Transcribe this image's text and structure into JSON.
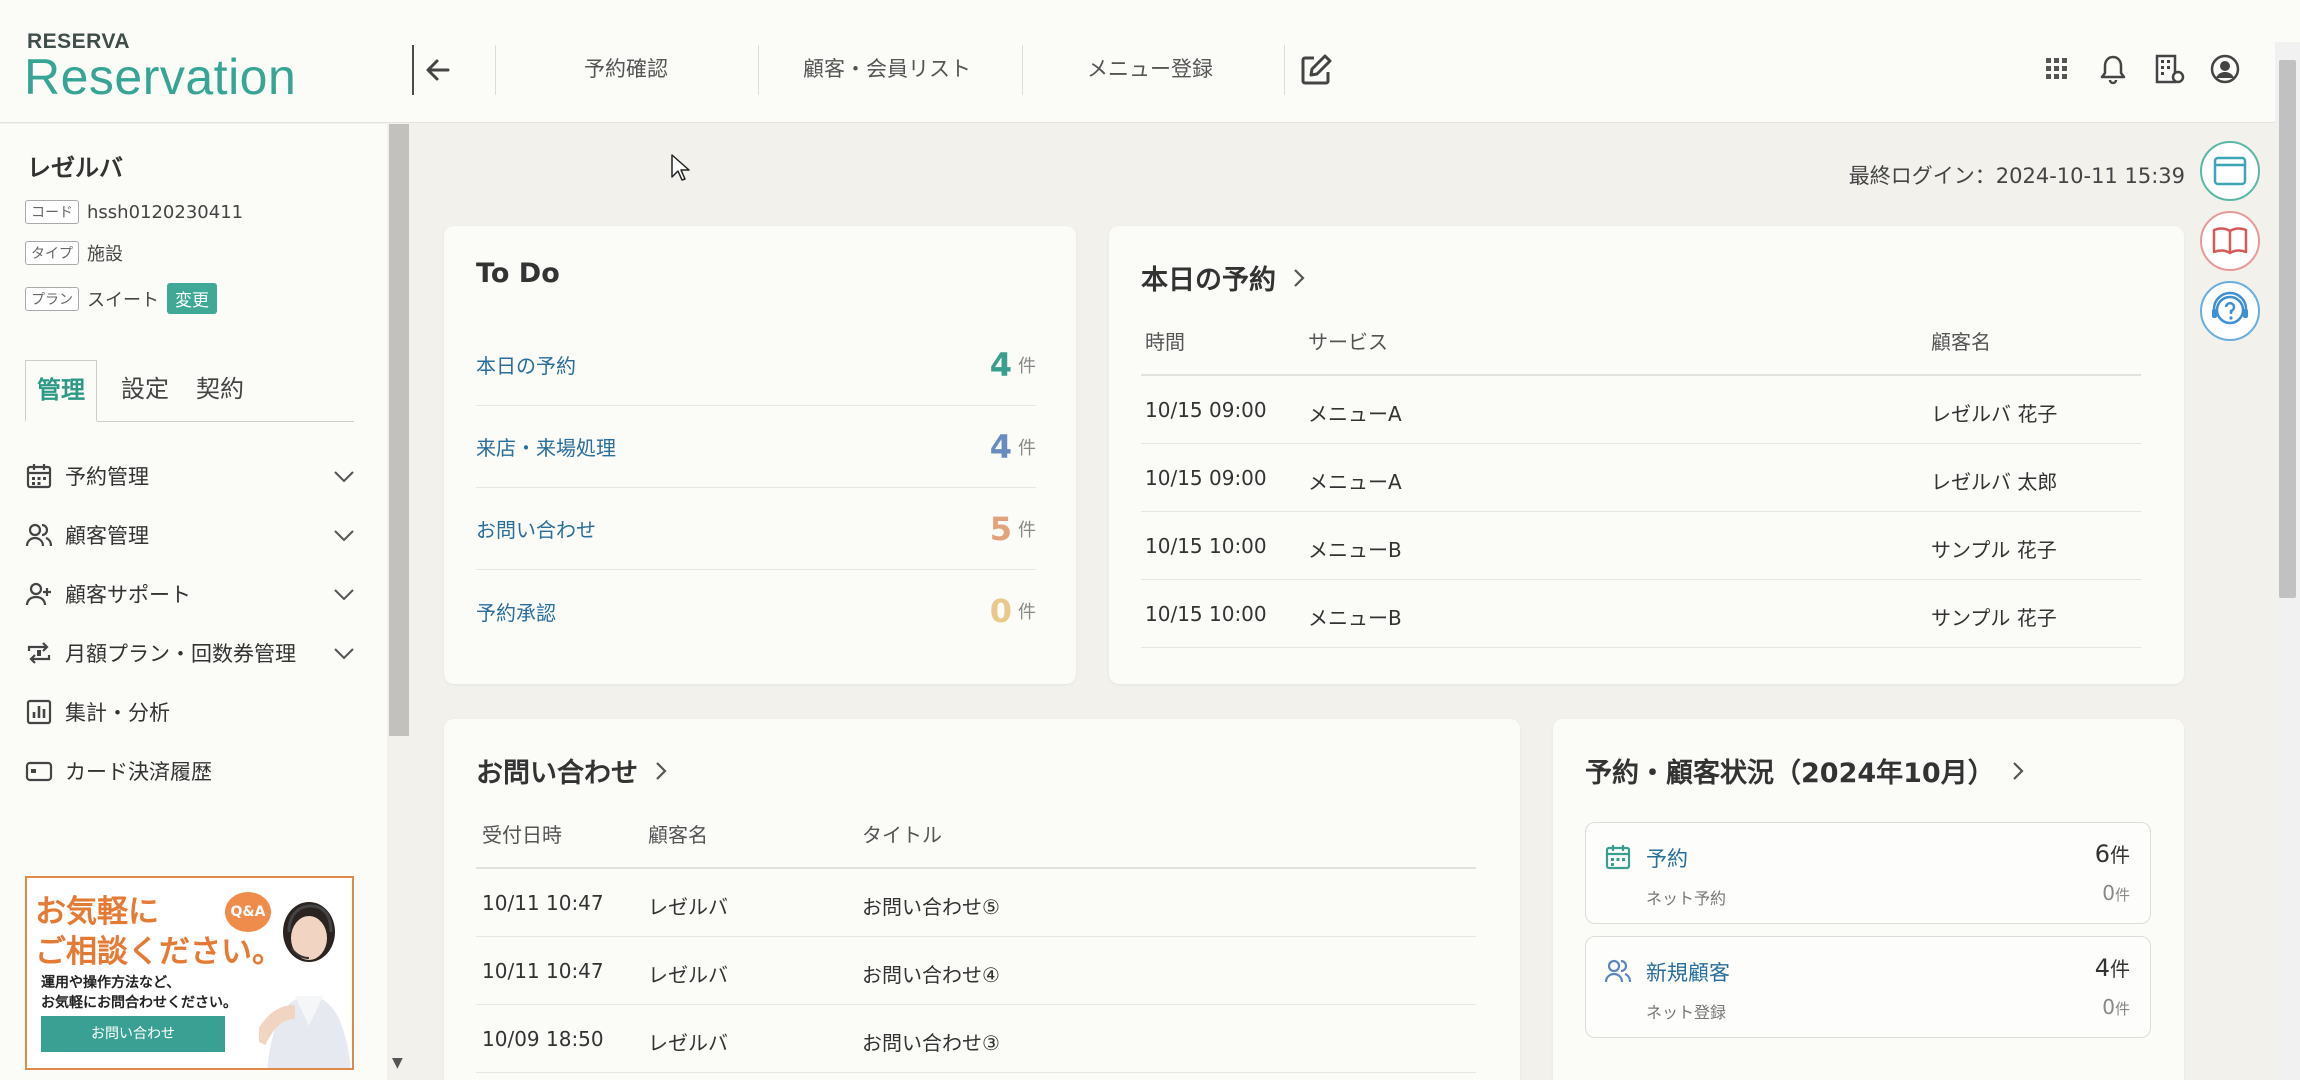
{
  "header": {
    "logo_small": "RESERVA",
    "logo_big": "Reservation",
    "nav": [
      "予約確認",
      "顧客・会員リスト",
      "メニュー登録"
    ],
    "icons": [
      "grid-icon",
      "bell-icon",
      "building-settings-icon",
      "account-icon"
    ]
  },
  "sidebar": {
    "org_name": "レゼルバ",
    "code_tag": "コード",
    "code_value": "hssh0120230411",
    "type_tag": "タイプ",
    "type_value": "施設",
    "plan_tag": "プラン",
    "plan_value": "スイート",
    "change_label": "変更",
    "tabs": [
      "管理",
      "設定",
      "契約"
    ],
    "menu": [
      {
        "label": "予約管理",
        "icon": "calendar-icon",
        "expandable": true
      },
      {
        "label": "顧客管理",
        "icon": "users-icon",
        "expandable": true
      },
      {
        "label": "顧客サポート",
        "icon": "user-plus-icon",
        "expandable": true
      },
      {
        "label": "月額プラン・回数券管理",
        "icon": "repeat-icon",
        "expandable": true
      },
      {
        "label": "集計・分析",
        "icon": "bar-chart-icon",
        "expandable": false
      },
      {
        "label": "カード決済履歴",
        "icon": "credit-card-icon",
        "expandable": false
      }
    ],
    "banner": {
      "line1": "お気軽に",
      "line2": "ご相談ください。",
      "sub1": "運用や操作方法など、",
      "sub2": "お気軽にお問合わせください。",
      "button": "お問い合わせ",
      "badge": "Q&A"
    }
  },
  "main": {
    "last_login": "最終ログイン：2024-10-11 15:39",
    "todo": {
      "title": "To Do",
      "unit": "件",
      "items": [
        {
          "label": "本日の予約",
          "count": "4",
          "color": "#3a9e8f"
        },
        {
          "label": "来店・来場処理",
          "count": "4",
          "color": "#6a8bbf"
        },
        {
          "label": "お問い合わせ",
          "count": "5",
          "color": "#e3a37a"
        },
        {
          "label": "予約承認",
          "count": "0",
          "color": "#e8c98a"
        }
      ]
    },
    "today": {
      "title": "本日の予約",
      "headers": [
        "時間",
        "サービス",
        "顧客名"
      ],
      "rows": [
        [
          "10/15 09:00",
          "メニューA",
          "レゼルバ 花子"
        ],
        [
          "10/15 09:00",
          "メニューA",
          "レゼルバ 太郎"
        ],
        [
          "10/15 10:00",
          "メニューB",
          "サンプル 花子"
        ],
        [
          "10/15 10:00",
          "メニューB",
          "サンプル 花子"
        ]
      ]
    },
    "inquiries": {
      "title": "お問い合わせ",
      "headers": [
        "受付日時",
        "顧客名",
        "タイトル"
      ],
      "rows": [
        [
          "10/11 10:47",
          "レゼルバ",
          "お問い合わせ⑤"
        ],
        [
          "10/11 10:47",
          "レゼルバ",
          "お問い合わせ④"
        ],
        [
          "10/09 18:50",
          "レゼルバ",
          "お問い合わせ③"
        ]
      ]
    },
    "status": {
      "title": "予約・顧客状況（2024年10月）",
      "boxes": [
        {
          "label": "予約",
          "value": "6",
          "unit": "件",
          "sub_label": "ネット予約",
          "sub_value": "0",
          "icon": "calendar-icon"
        },
        {
          "label": "新規顧客",
          "value": "4",
          "unit": "件",
          "sub_label": "ネット登録",
          "sub_value": "0",
          "icon": "users-icon"
        }
      ]
    },
    "side_buttons": [
      "browser-window-icon",
      "book-icon",
      "help-headset-icon"
    ]
  }
}
